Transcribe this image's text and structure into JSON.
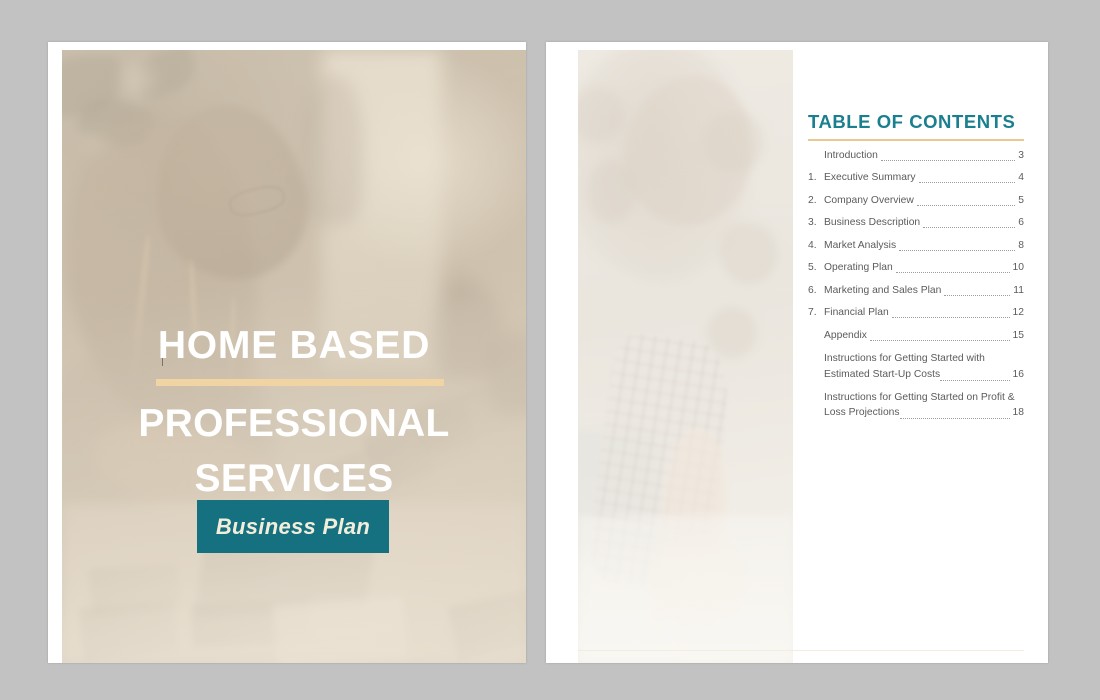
{
  "document": {
    "title": "Home Based Professional Services Business Plan",
    "background_color": "#c2c2c2"
  },
  "cover": {
    "title_line_1": "HOME BASED",
    "title_line_2": "PROFESSIONAL SERVICES",
    "badge_label": "Business Plan",
    "accent_rule_color": "#f0d4a3",
    "badge_color": "#15707f",
    "badge_text_color": "#f3eddc",
    "title_color": "#ffffff",
    "photo_alt": "Washed-out photograph of a woman wearing glasses working at a desk with a laptop and papers"
  },
  "toc": {
    "heading": "TABLE OF CONTENTS",
    "heading_color": "#1a7f8e",
    "rule_color": "#e8c893",
    "photo_alt": "Faded photograph of a woman with curly hair in a plaid shirt leaning over a table",
    "entries": [
      {
        "num": "",
        "label": "Introduction",
        "page": "3",
        "level": 1
      },
      {
        "num": "1.",
        "label": "Executive Summary",
        "page": "4",
        "level": 2
      },
      {
        "num": "2.",
        "label": "Company Overview",
        "page": "5",
        "level": 2
      },
      {
        "num": "3.",
        "label": "Business Description",
        "page": "6",
        "level": 2
      },
      {
        "num": "4.",
        "label": "Market Analysis",
        "page": "8",
        "level": 2
      },
      {
        "num": "5.",
        "label": "Operating Plan",
        "page": "10",
        "level": 2
      },
      {
        "num": "6.",
        "label": "Marketing and Sales Plan",
        "page": "11",
        "level": 2
      },
      {
        "num": "7.",
        "label": "Financial Plan",
        "page": "12",
        "level": 2
      },
      {
        "num": "",
        "label": "Appendix",
        "page": "15",
        "level": 1
      }
    ],
    "sub_entries": [
      {
        "line1": "Instructions for Getting Started with",
        "line2": "Estimated Start-Up Costs",
        "page": "16"
      },
      {
        "line1": "Instructions for Getting Started on Profit &",
        "line2": "Loss Projections",
        "page": "18"
      }
    ]
  }
}
